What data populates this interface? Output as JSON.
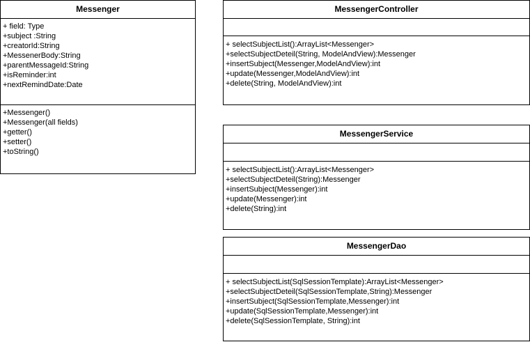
{
  "classes": {
    "messenger": {
      "name": "Messenger",
      "attributes": [
        "+ field: Type",
        "+subject :String",
        "+creatorId:String",
        "+MessenerBody:String",
        "+parentMessageId:String",
        "+isReminder:int",
        "+nextRemindDate:Date"
      ],
      "methods": [
        "+Messenger()",
        "+Messenger(all fields)",
        "+getter()",
        "+setter()",
        "+toString()"
      ]
    },
    "controller": {
      "name": "MessengerController",
      "attributes": [],
      "methods": [
        "+ selectSubjectList():ArrayList<Messenger>",
        "+selectSubjectDeteil(String, ModelAndView):Messenger",
        "+insertSubject(Messenger,ModelAndView):int",
        "+update(Messenger,ModelAndView):int",
        "+delete(String, ModelAndView):int"
      ]
    },
    "service": {
      "name": "MessengerService",
      "attributes": [],
      "methods": [
        "+ selectSubjectList():ArrayList<Messenger>",
        "+selectSubjectDeteil(String):Messenger",
        "+insertSubject(Messenger):int",
        "+update(Messenger):int",
        "+delete(String):int"
      ]
    },
    "dao": {
      "name": "MessengerDao",
      "attributes": [],
      "methods": [
        "+ selectSubjectList(SqlSessionTemplate):ArrayList<Messenger>",
        "+selectSubjectDeteil(SqlSessionTemplate,String):Messenger",
        "+insertSubject(SqlSessionTemplate,Messenger):int",
        "+update(SqlSessionTemplate,Messenger):int",
        "+delete(SqlSessionTemplate, String):int"
      ]
    }
  }
}
